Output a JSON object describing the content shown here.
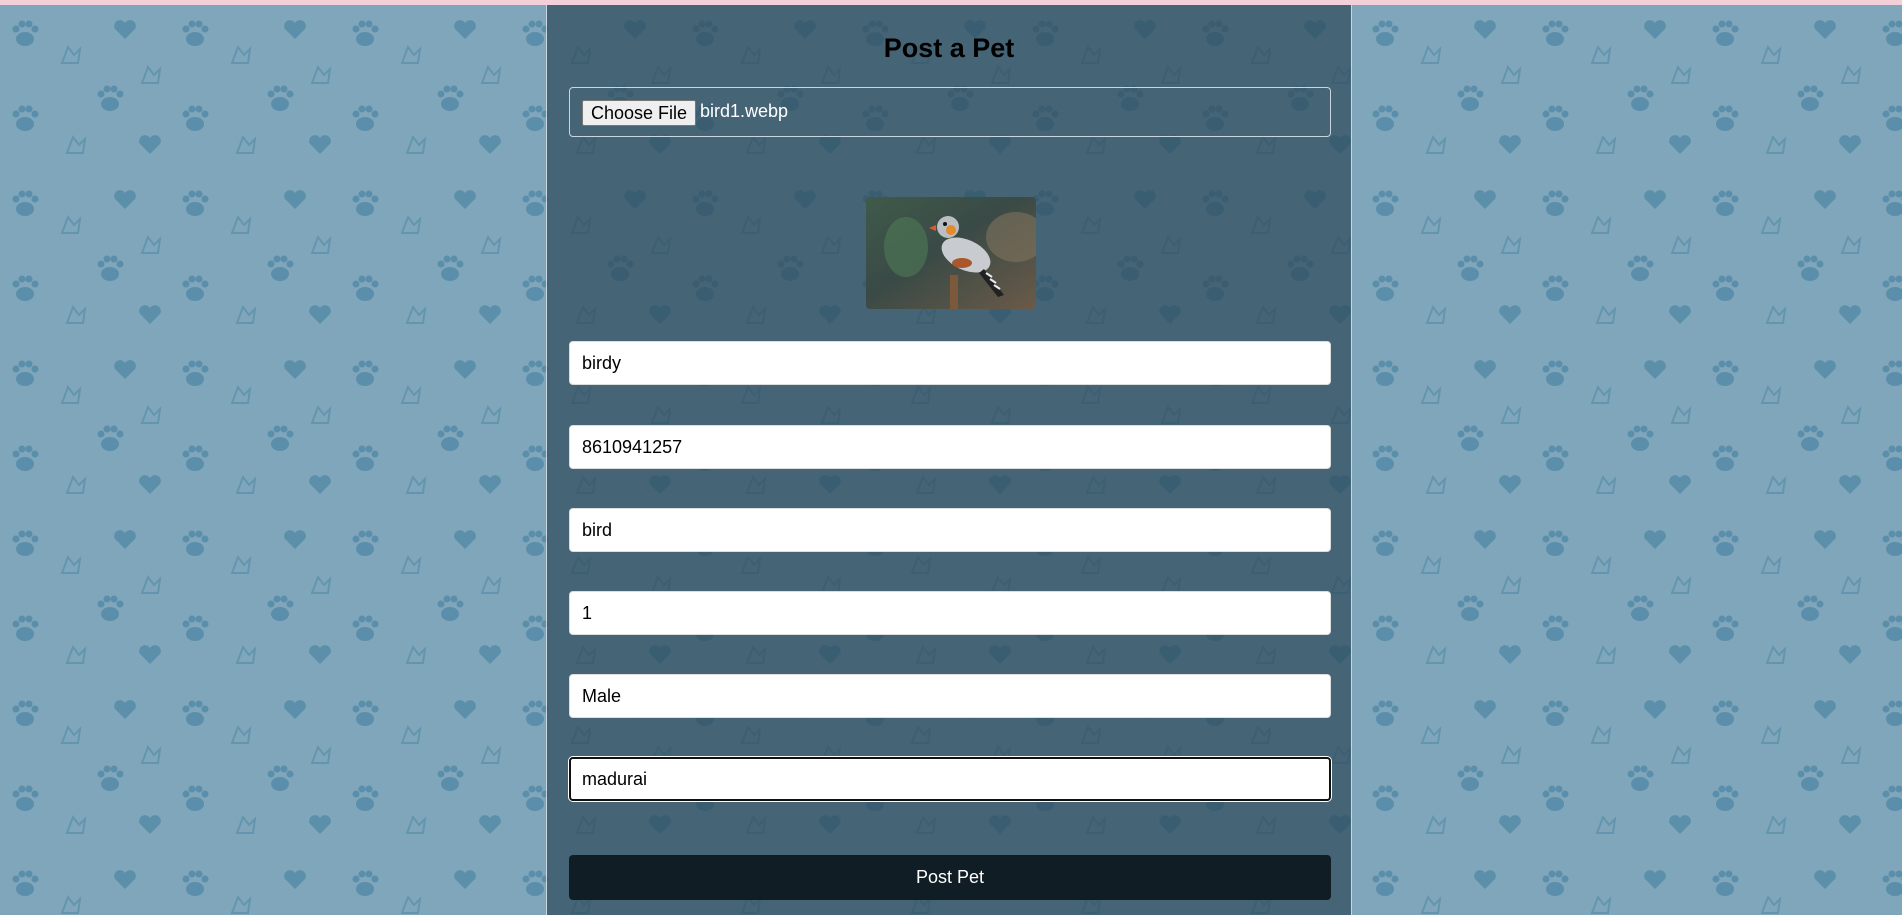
{
  "form": {
    "title": "Post a Pet",
    "file_button_label": "Choose File",
    "file_name": "bird1.webp",
    "preview_image": "bird-photo",
    "fields": {
      "name": "birdy",
      "phone": "8610941257",
      "type": "bird",
      "age": "1",
      "gender": "Male",
      "location": "madurai"
    },
    "submit_label": "Post Pet"
  },
  "colors": {
    "background": "#7fa6bb",
    "paw_pattern": "#4f86a4",
    "panel": "#3d5a69",
    "submit_button": "#111d25",
    "top_bar": "#f2cfd9"
  }
}
